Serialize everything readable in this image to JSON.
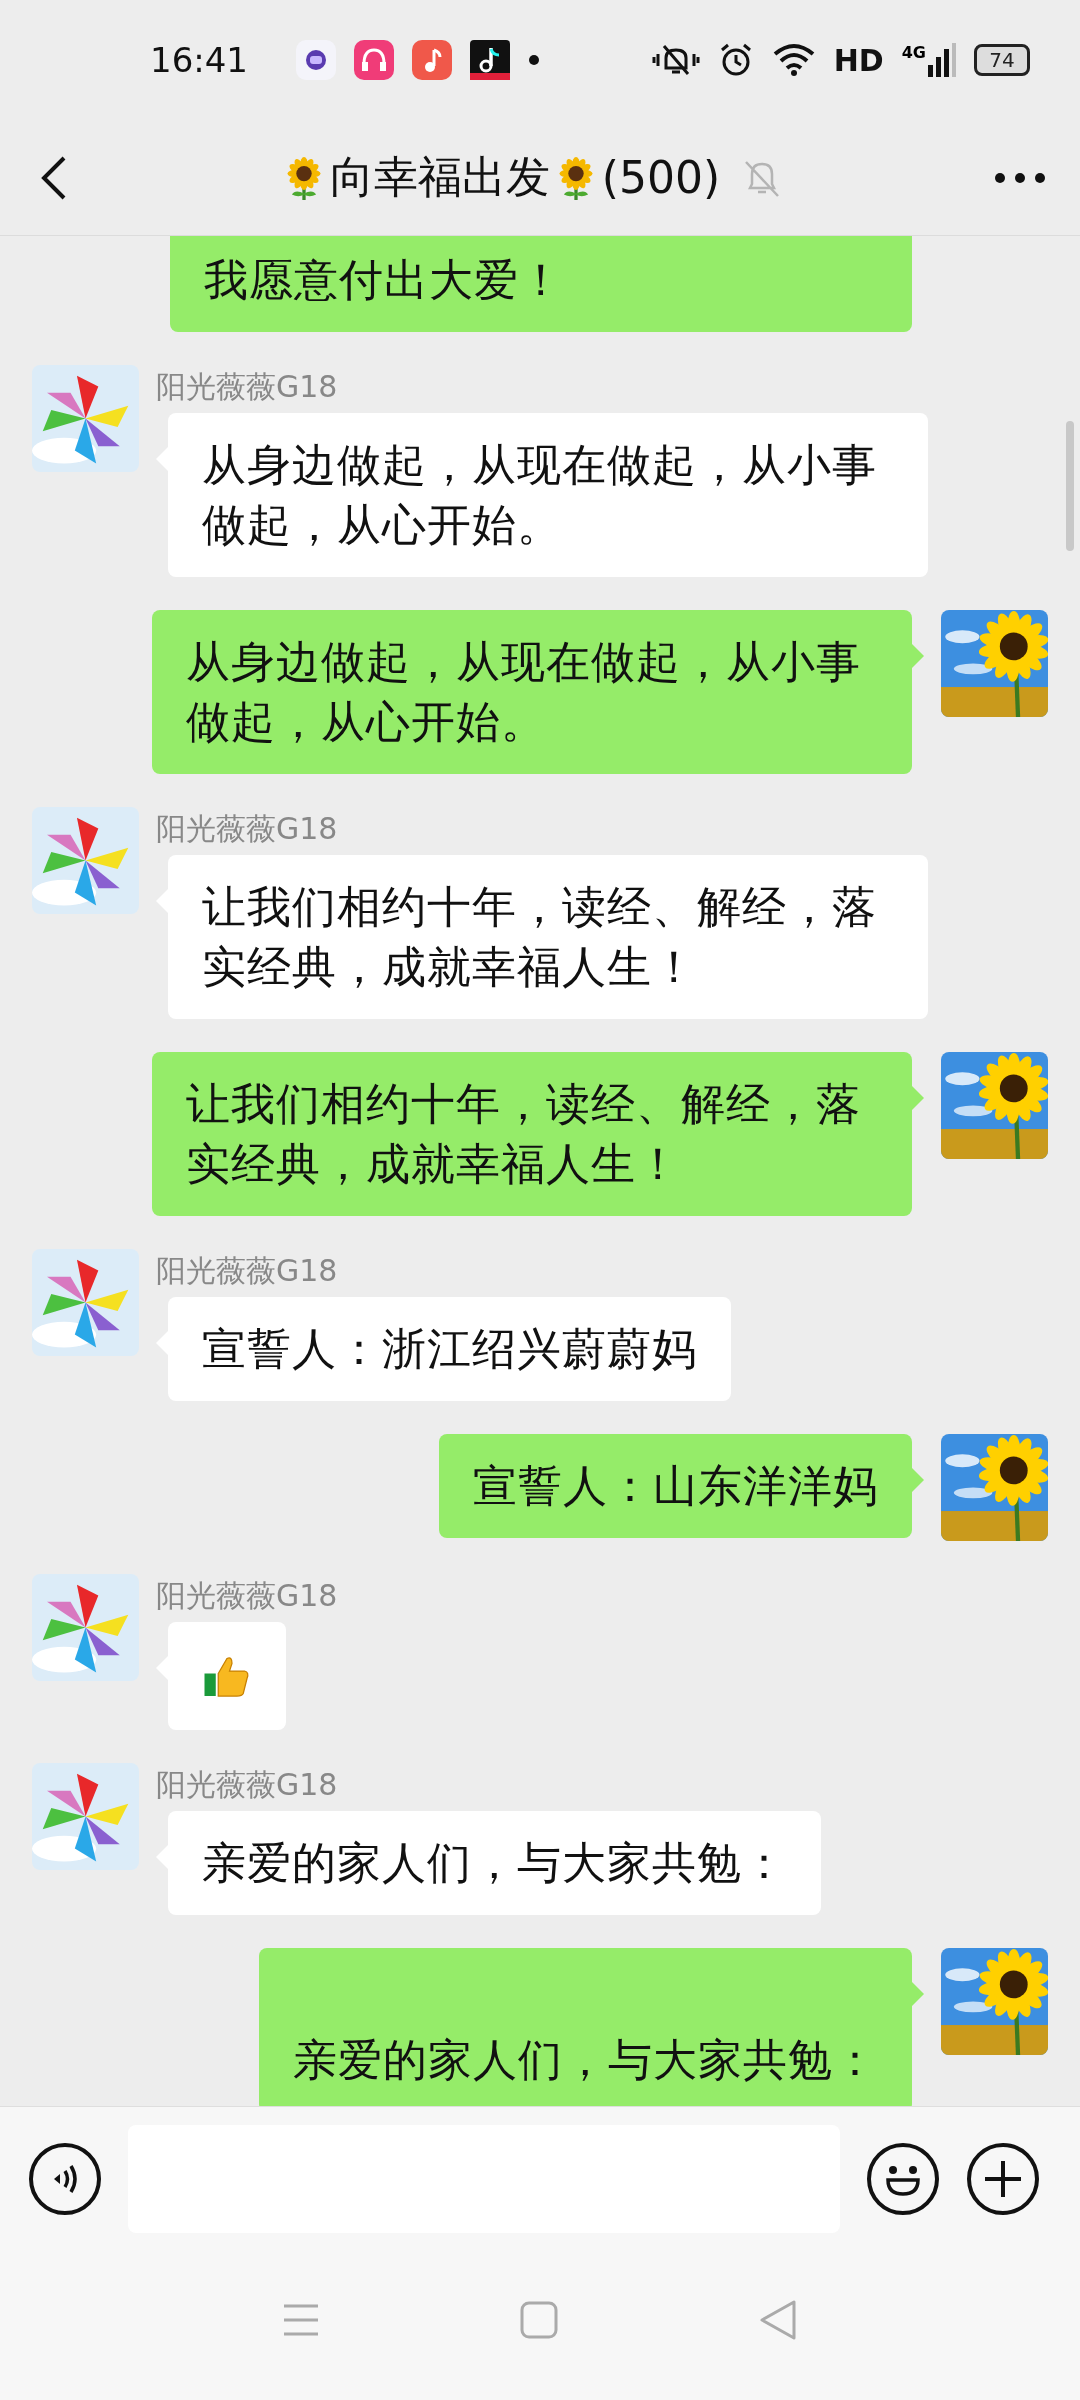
{
  "status_bar": {
    "time": "16:41",
    "hd": "HD",
    "network": "4G",
    "battery": "74"
  },
  "header": {
    "title": "向幸福出发",
    "member_count": "(500)",
    "muted": true
  },
  "messages": [
    {
      "kind": "outgoing",
      "text": "我愿意付出大爱！",
      "clipped": true
    },
    {
      "kind": "incoming",
      "name": "阳光薇薇G18",
      "text": "从身边做起，从现在做起，从小事做起，从心开始。"
    },
    {
      "kind": "outgoing",
      "text": "从身边做起，从现在做起，从小事做起，从心开始。"
    },
    {
      "kind": "incoming",
      "name": "阳光薇薇G18",
      "text": "让我们相约十年，读经、解经，落实经典，成就幸福人生！"
    },
    {
      "kind": "outgoing",
      "text": "让我们相约十年，读经、解经，落实经典，成就幸福人生！"
    },
    {
      "kind": "incoming",
      "name": "阳光薇薇G18",
      "text": "宣誓人：浙江绍兴蔚蔚妈"
    },
    {
      "kind": "outgoing",
      "text": "宣誓人：山东洋洋妈"
    },
    {
      "kind": "sticker",
      "name": "阳光薇薇G18"
    },
    {
      "kind": "incoming",
      "name": "阳光薇薇G18",
      "text": "亲爱的家人们，与大家共勉："
    },
    {
      "kind": "outgoing",
      "text": "\n亲爱的家人们，与大家共勉："
    }
  ]
}
